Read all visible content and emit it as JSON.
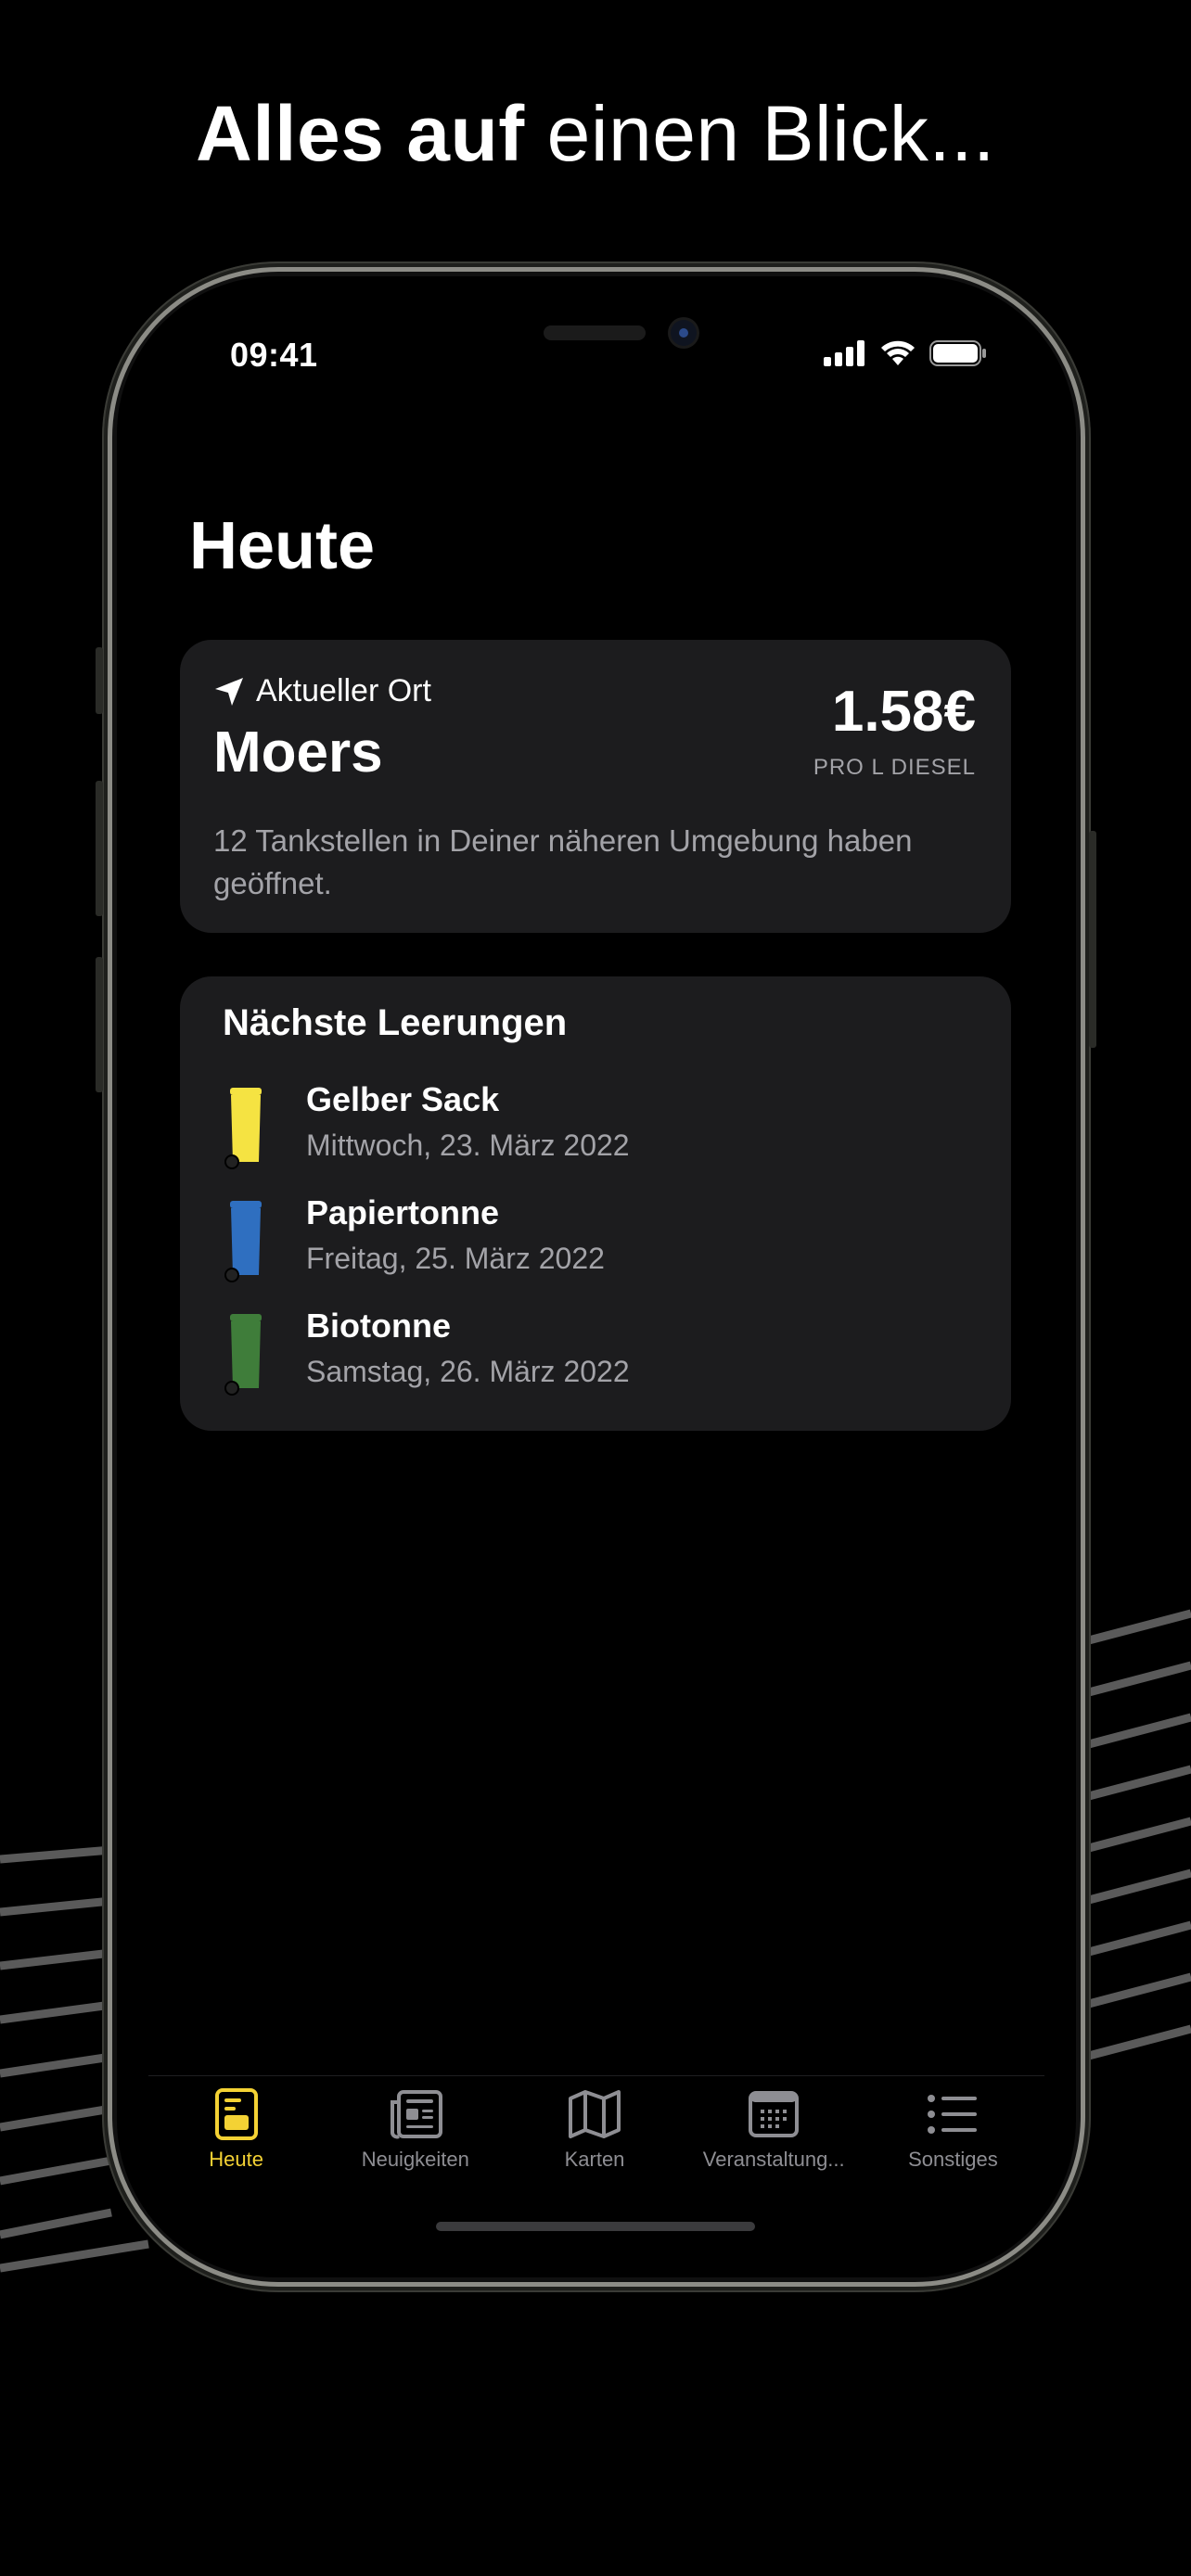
{
  "headline": {
    "bold": "Alles auf",
    "light": "einen Blick..."
  },
  "status_bar": {
    "time": "09:41"
  },
  "page_title": "Heute",
  "location_card": {
    "label": "Aktueller Ort",
    "city": "Moers",
    "price": "1.58€",
    "price_unit": "PRO L DIESEL",
    "description": "12 Tankstellen in Deiner näheren Umgebung haben geöffnet."
  },
  "waste_card": {
    "title": "Nächste Leerungen",
    "items": [
      {
        "name": "Gelber Sack",
        "date": "Mittwoch, 23. März 2022",
        "color": "#f5e342"
      },
      {
        "name": "Papiertonne",
        "date": "Freitag, 25. März 2022",
        "color": "#2f6fc0"
      },
      {
        "name": "Biotonne",
        "date": "Samstag, 26. März 2022",
        "color": "#3f7d3a"
      }
    ]
  },
  "tabs": [
    {
      "label": "Heute",
      "icon": "today-icon",
      "active": true
    },
    {
      "label": "Neuigkeiten",
      "icon": "newspaper-icon",
      "active": false
    },
    {
      "label": "Karten",
      "icon": "map-icon",
      "active": false
    },
    {
      "label": "Veranstaltung...",
      "icon": "calendar-icon",
      "active": false
    },
    {
      "label": "Sonstiges",
      "icon": "list-icon",
      "active": false
    }
  ],
  "colors": {
    "accent": "#f4d234",
    "card": "#1c1c1e",
    "secondary_text": "#a3a3a8"
  }
}
